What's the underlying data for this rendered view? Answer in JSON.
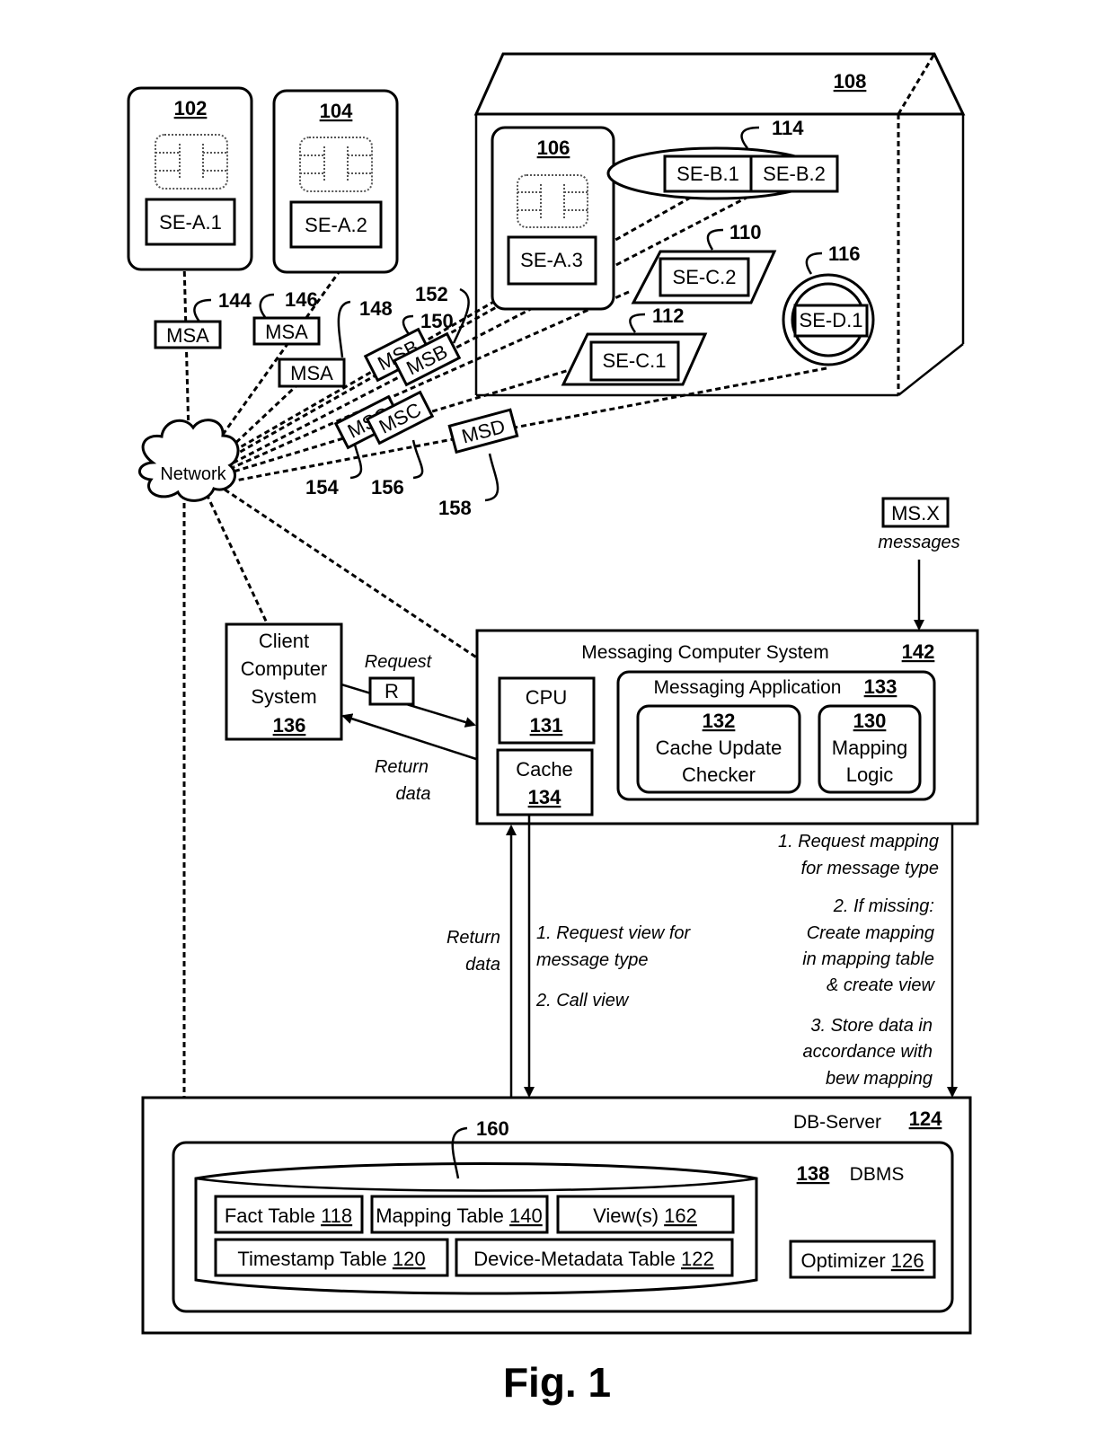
{
  "figure": {
    "caption": "Fig. 1",
    "cards": [
      {
        "ref": "102",
        "label": "SE-A.1"
      },
      {
        "ref": "104",
        "label": "SE-A.2"
      },
      {
        "ref": "106",
        "label": "SE-A.3"
      }
    ],
    "device_108": {
      "ref": "108",
      "group_114": {
        "ref": "114",
        "items": [
          "SE-B.1",
          "SE-B.2"
        ]
      },
      "item_110": {
        "ref": "110",
        "label": "SE-C.2"
      },
      "item_112": {
        "ref": "112",
        "label": "SE-C.1"
      },
      "item_116": {
        "ref": "116",
        "label": "SE-D.1"
      }
    },
    "messages": [
      {
        "ref": "144",
        "label": "MSA"
      },
      {
        "ref": "146",
        "label": "MSA"
      },
      {
        "ref": "148",
        "label": "MSA"
      },
      {
        "ref": "150",
        "label": "MSB"
      },
      {
        "ref": "152",
        "label": "MSB"
      },
      {
        "ref": "154",
        "label": "MSC"
      },
      {
        "ref": "156",
        "label": "MSC"
      },
      {
        "ref": "158",
        "label": "MSD"
      }
    ],
    "network": {
      "label": "Network"
    },
    "msx": {
      "label": "MS.X",
      "caption": "messages"
    },
    "client": {
      "line1": "Client",
      "line2": "Computer",
      "line3": "System",
      "ref": "136"
    },
    "request": {
      "label": "Request",
      "box": "R"
    },
    "return_data_client": {
      "line1": "Return",
      "line2": "data"
    },
    "messaging_system": {
      "title": "Messaging Computer System",
      "ref": "142",
      "cpu": {
        "label": "CPU",
        "ref": "131"
      },
      "cache": {
        "label": "Cache",
        "ref": "134"
      },
      "app": {
        "title": "Messaging Application",
        "ref": "133",
        "checker": {
          "ref": "132",
          "line1": "Cache Update",
          "line2": "Checker"
        },
        "mapping": {
          "ref": "130",
          "line1": "Mapping",
          "line2": "Logic"
        }
      }
    },
    "cache_flow": {
      "return_line1": "Return",
      "return_line2": "data",
      "req_line1": "1. Request view for",
      "req_line2": "message type",
      "call": "2. Call view"
    },
    "mapping_flow": [
      "1. Request mapping",
      "for message type",
      "2. If missing:",
      "Create mapping",
      "in mapping table",
      "& create view",
      "3. Store data in",
      "accordance with",
      "bew mapping"
    ],
    "db_server": {
      "title": "DB-Server",
      "ref": "124",
      "dbms": {
        "ref": "138",
        "label": "DBMS"
      },
      "storage_ref": "160",
      "tables": [
        {
          "label": "Fact Table",
          "ref": "118"
        },
        {
          "label": "Mapping Table",
          "ref": "140"
        },
        {
          "label": "View(s)",
          "ref": "162"
        },
        {
          "label": "Timestamp Table",
          "ref": "120"
        },
        {
          "label": "Device-Metadata Table",
          "ref": "122"
        }
      ],
      "optimizer": {
        "label": "Optimizer",
        "ref": "126"
      }
    }
  }
}
